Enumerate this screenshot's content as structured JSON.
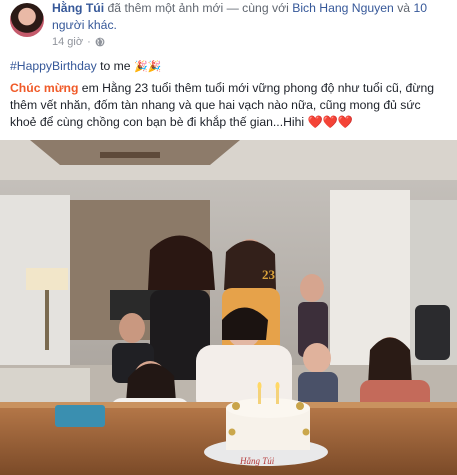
{
  "post": {
    "author": "Hằng Túi",
    "action_text": " đã thêm một ảnh mới — cùng với ",
    "tagged_person": "Bich Hang Nguyen",
    "and_text": " và ",
    "others": "10 người khác.",
    "time": "14 giờ",
    "separator": "·",
    "hashtag": "#HappyBirthday",
    "to_me": " to me",
    "party_emoji": "🎉🎉",
    "highlight": "Chúc mừng",
    "message": " em Hằng 23 tuổi thêm tuổi mới vững phong độ như tuổi cũ, đừng thêm vết nhăn, đốm tàn nhang và que hai vạch nào nữa, cũng mong đủ sức khoẻ để cùng chồng con bạn bè đi khắp thế gian...Hihi ",
    "hearts": "❤️❤️❤️"
  },
  "photo": {
    "cake_text": "Hằng Túi",
    "cake_number": "23"
  },
  "colors": {
    "link": "#365899",
    "highlight": "#f05a28",
    "meta": "#90949c"
  },
  "icons": [
    "globe-icon"
  ]
}
